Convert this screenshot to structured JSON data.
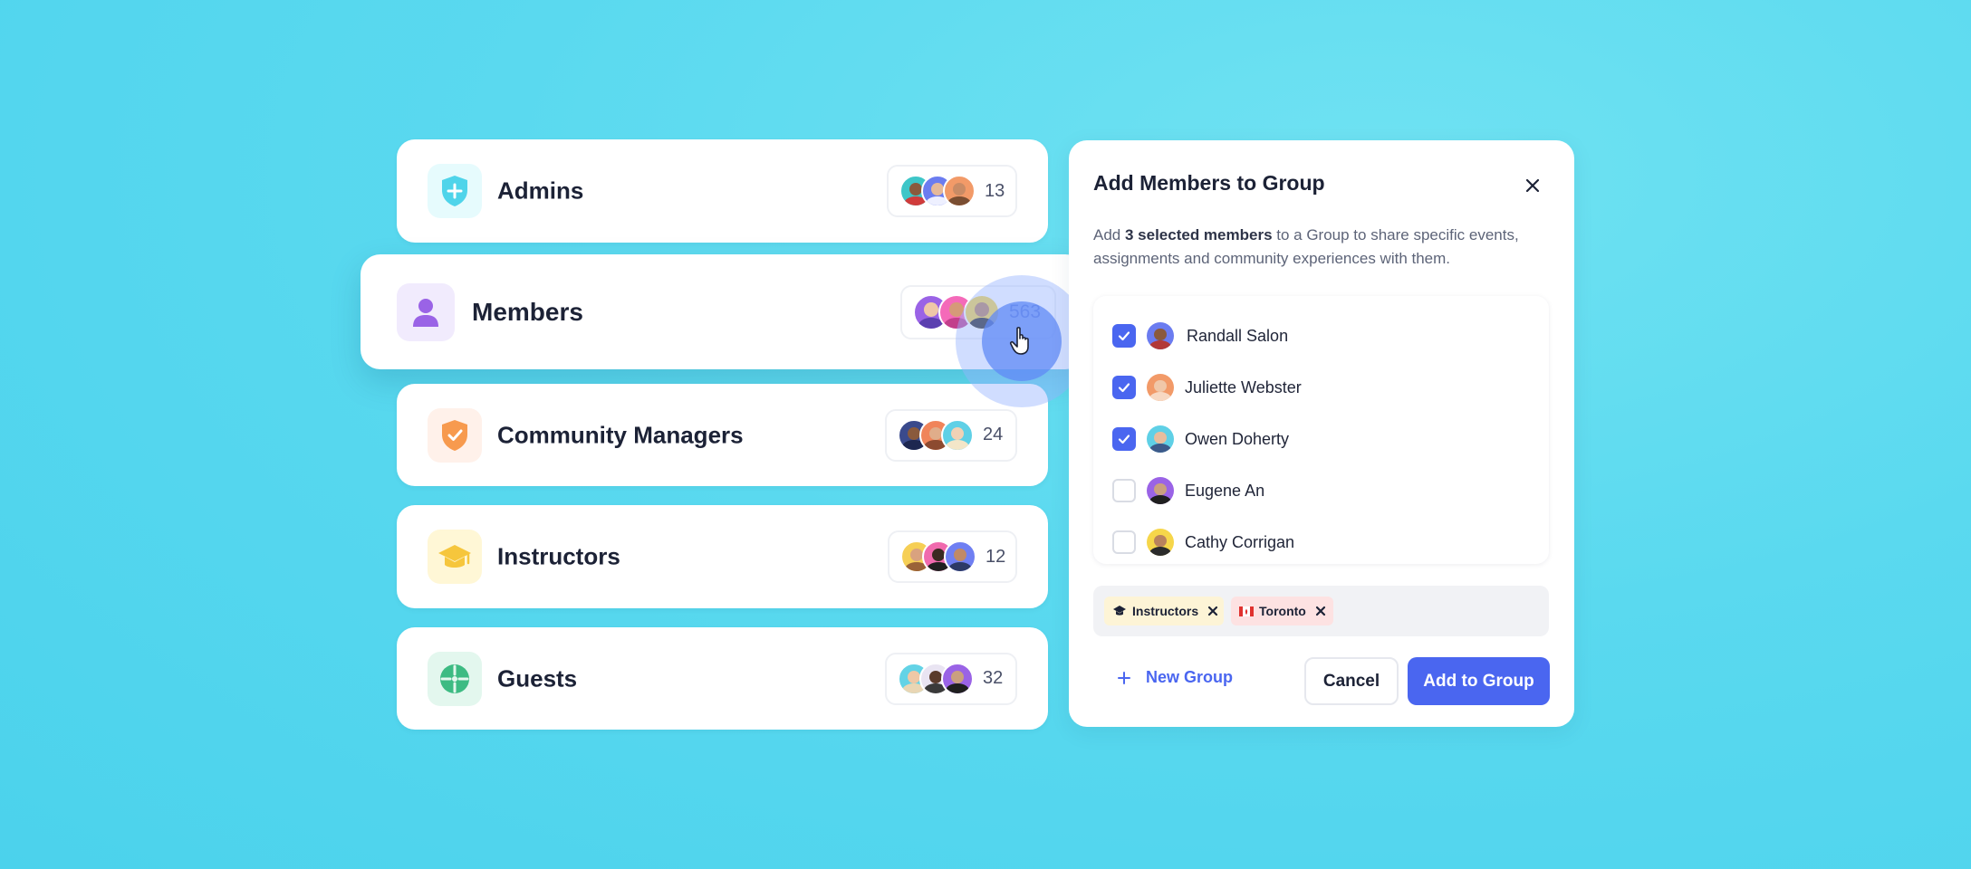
{
  "colors": {
    "background": "#5ad9ef",
    "accent": "#4a66f0",
    "admins_icon": "#4fd4ea",
    "members_icon": "#9a63e6",
    "community_managers_icon": "#f79a4e",
    "instructors_icon": "#f6c63c",
    "guests_icon": "#3dbb83"
  },
  "groups": [
    {
      "name": "Admins",
      "icon": "shield-plus-icon",
      "count": "13"
    },
    {
      "name": "Members",
      "icon": "user-icon",
      "count": "563"
    },
    {
      "name": "Community Managers",
      "icon": "shield-check-icon",
      "count": "24"
    },
    {
      "name": "Instructors",
      "icon": "graduation-cap-icon",
      "count": "12"
    },
    {
      "name": "Guests",
      "icon": "compass-icon",
      "count": "32"
    }
  ],
  "modal": {
    "title": "Add Members to Group",
    "close_icon": "close-icon",
    "description_prefix": "Add ",
    "description_bold": "3 selected members",
    "description_suffix": " to a Group to share specific events, assignments and community experiences with them.",
    "members": [
      {
        "name": "Randall Salon",
        "checked": true
      },
      {
        "name": "Juliette Webster",
        "checked": true
      },
      {
        "name": "Owen Doherty",
        "checked": true
      },
      {
        "name": "Eugene An",
        "checked": false
      },
      {
        "name": "Cathy Corrigan",
        "checked": false
      }
    ],
    "tags": [
      {
        "label": "Instructors",
        "icon": "graduation-cap-icon"
      },
      {
        "label": "Toronto",
        "icon": "canada-flag-icon"
      }
    ],
    "new_group_label": "New Group",
    "cancel_label": "Cancel",
    "add_label": "Add to Group"
  }
}
